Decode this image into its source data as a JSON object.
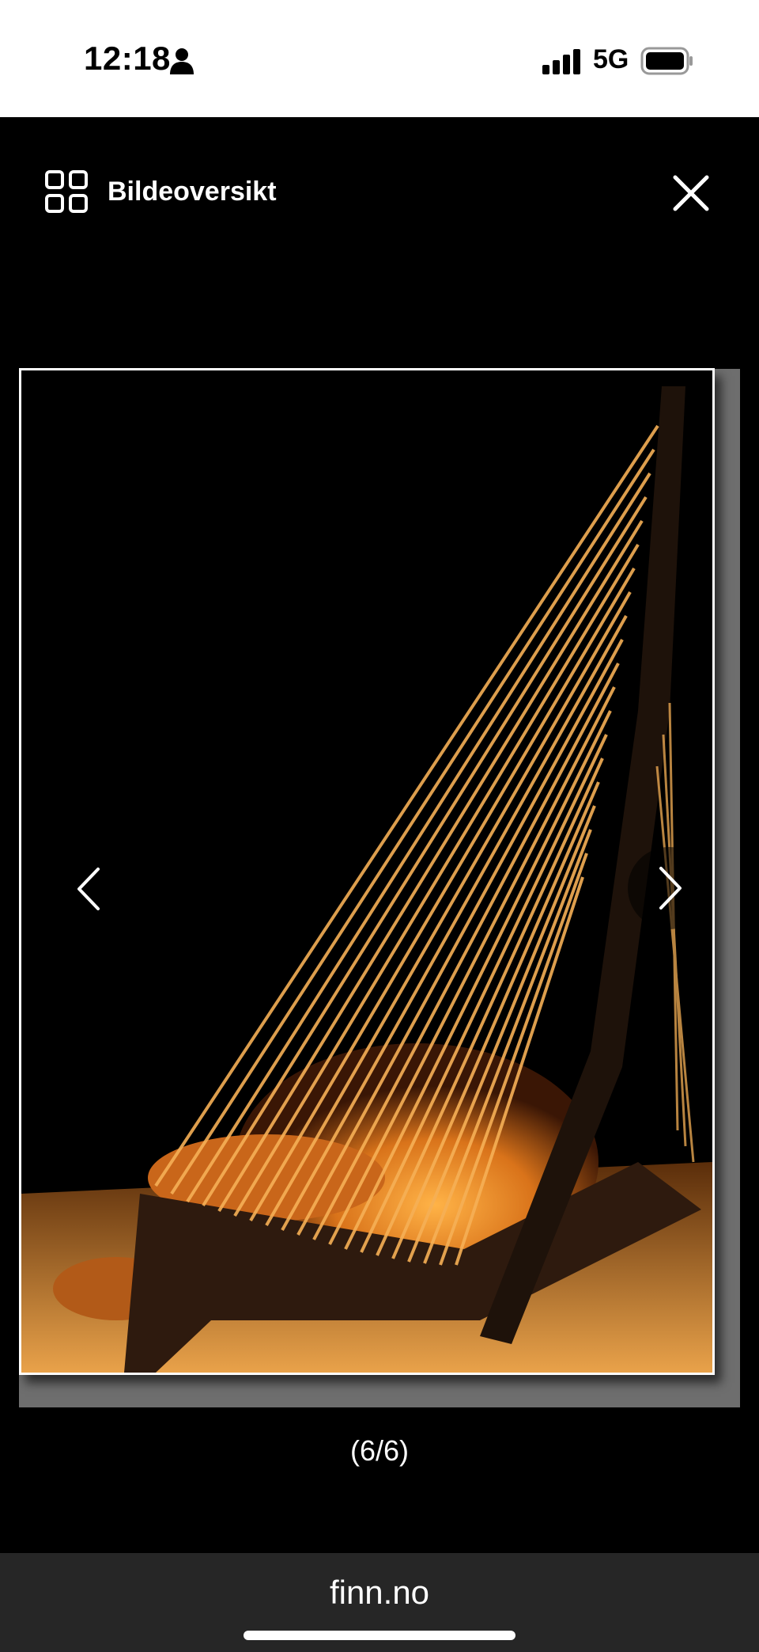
{
  "status_bar": {
    "time": "12:18",
    "network": "5G",
    "icons": [
      "person-icon",
      "signal-icon",
      "battery-icon"
    ]
  },
  "header": {
    "overview_label": "Bildeoversikt",
    "overview_icon": "grid-icon",
    "close_icon": "close-icon"
  },
  "viewer": {
    "image_alt": "Harp chair photo",
    "prev_icon": "chevron-left-icon",
    "next_icon": "chevron-right-icon",
    "counter": "(6/6)"
  },
  "browser": {
    "url": "finn.no"
  },
  "colors": {
    "background": "#000000",
    "status_bar": "#ffffff",
    "browser_bar": "#262626",
    "accent_warm": "#f2a23a"
  }
}
